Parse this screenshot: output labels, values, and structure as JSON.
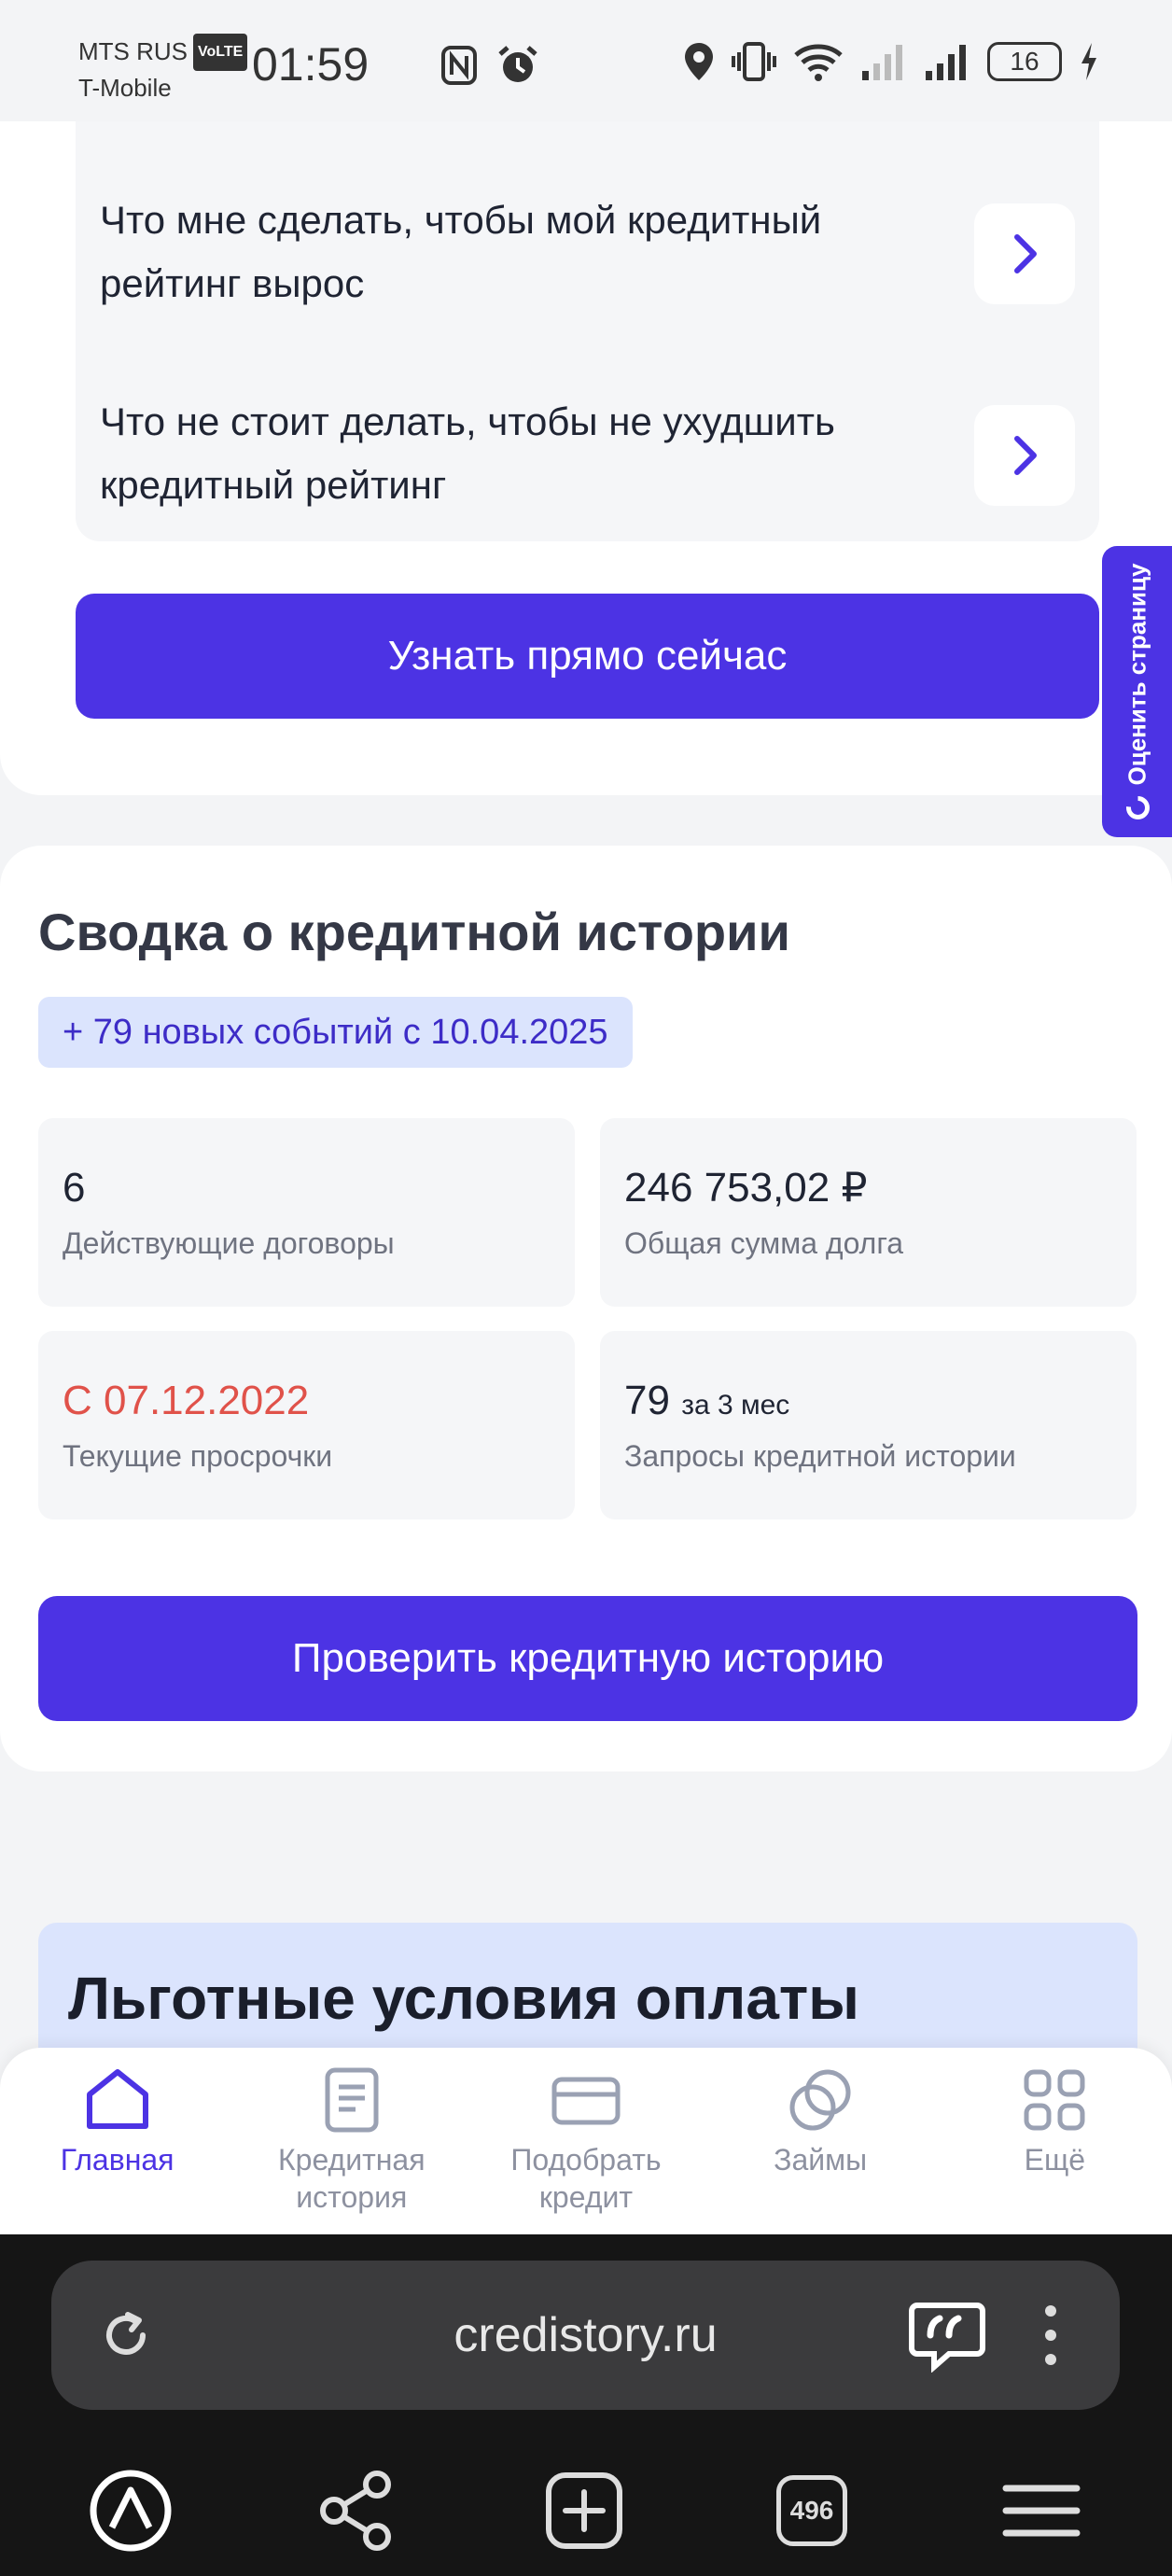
{
  "status_bar": {
    "carrier_1": "MTS RUS",
    "volte": "VoLTE",
    "carrier_2": "T-Mobile",
    "time": "01:59",
    "battery": "16"
  },
  "faq": {
    "items": [
      {
        "text": "Что мне сделать, чтобы мой кредитный рейтинг вырос"
      },
      {
        "text": "Что не стоит делать, чтобы не ухудшить кредитный рейтинг"
      }
    ]
  },
  "cta": {
    "find_out_label": "Узнать прямо сейчас"
  },
  "rate_tab": {
    "label": "Оценить страницу"
  },
  "summary": {
    "title": "Сводка о кредитной истории",
    "events_badge": "+ 79 новых событий с 10.04.2025",
    "stats": {
      "contracts": {
        "value": "6",
        "label": "Действующие договоры"
      },
      "debt": {
        "value": "246 753,02 ₽",
        "label": "Общая сумма долга"
      },
      "overdue": {
        "value": "С 07.12.2022",
        "label": "Текущие просрочки"
      },
      "requests": {
        "value": "79",
        "suffix": "за 3 мес",
        "label": "Запросы кредитной истории"
      }
    },
    "check_label": "Проверить кредитную историю"
  },
  "promo": {
    "title": "Льготные условия оплаты"
  },
  "bottom_nav": {
    "home": "Главная",
    "credit_history": "Кредитная история",
    "pick_credit": "Подобрать кредит",
    "loans": "Займы",
    "more": "Ещё"
  },
  "browser": {
    "url": "credistory.ru",
    "tabs_count": "496"
  },
  "colors": {
    "accent": "#4c33e4",
    "overdue": "#e0524a",
    "badge_bg": "#dbe4fd"
  }
}
